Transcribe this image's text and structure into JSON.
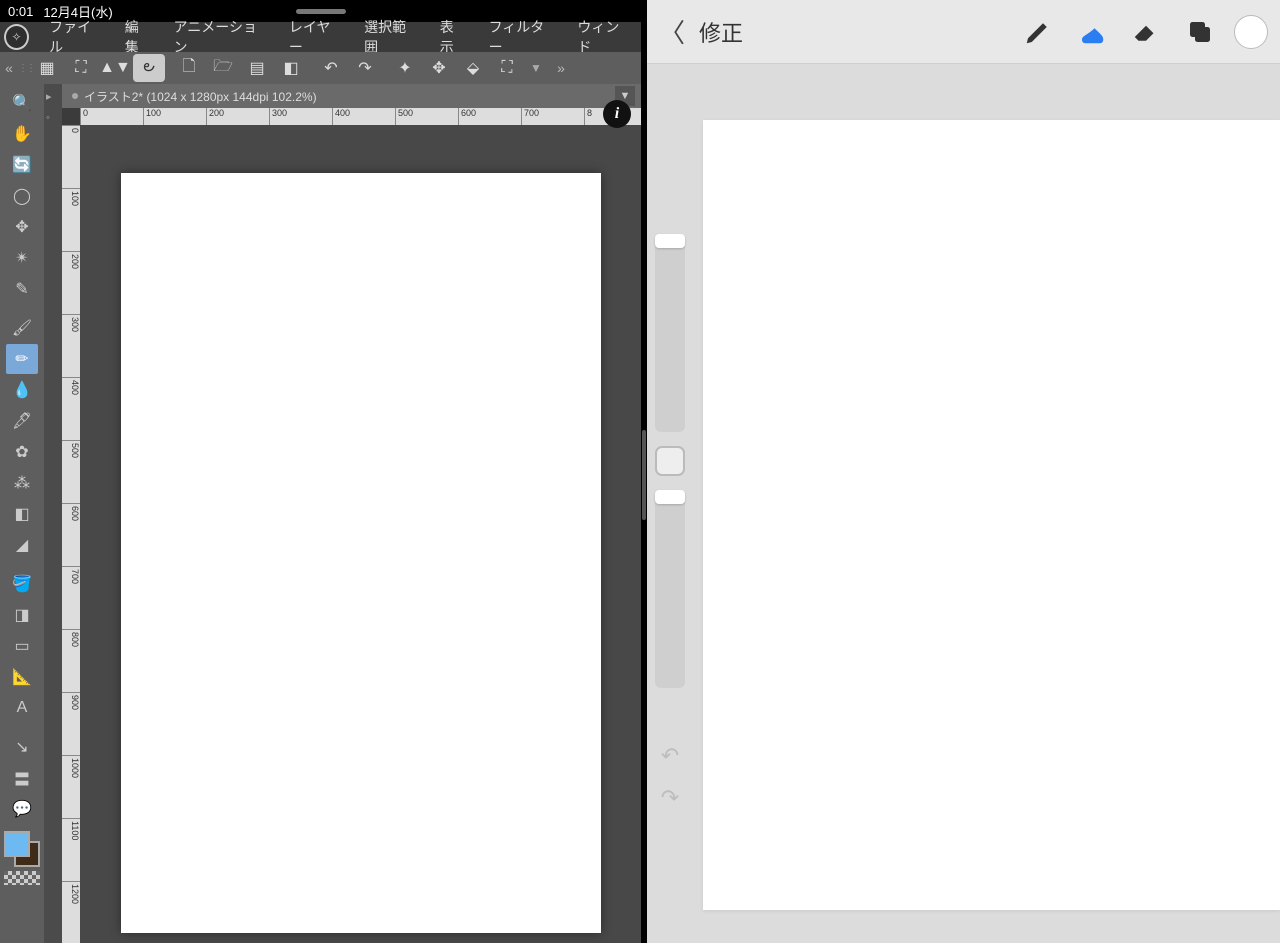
{
  "status": {
    "time": "0:01",
    "date": "12月4日(水)"
  },
  "leftApp": {
    "menus": [
      "ファイル",
      "編集",
      "アニメーション",
      "レイヤー",
      "選択範囲",
      "表示",
      "フィルター",
      "ウィンド"
    ],
    "docTab": "イラスト2* (1024 x 1280px 144dpi 102.2%)",
    "rulerH": [
      "0",
      "100",
      "200",
      "300",
      "400",
      "500",
      "600",
      "700",
      "8"
    ],
    "rulerV": [
      "0",
      "100",
      "200",
      "300",
      "400",
      "500",
      "600",
      "700",
      "800",
      "900",
      "1000",
      "1100",
      "1200"
    ],
    "colors": {
      "fg": "#6db9f2",
      "bg": "#402a18"
    }
  },
  "rightApp": {
    "backLabel": "修正",
    "tools": {
      "brush": "brush-icon",
      "smudge": "smudge-icon",
      "eraser": "eraser-icon",
      "layers": "layers-icon"
    },
    "activeTool": "smudge"
  }
}
